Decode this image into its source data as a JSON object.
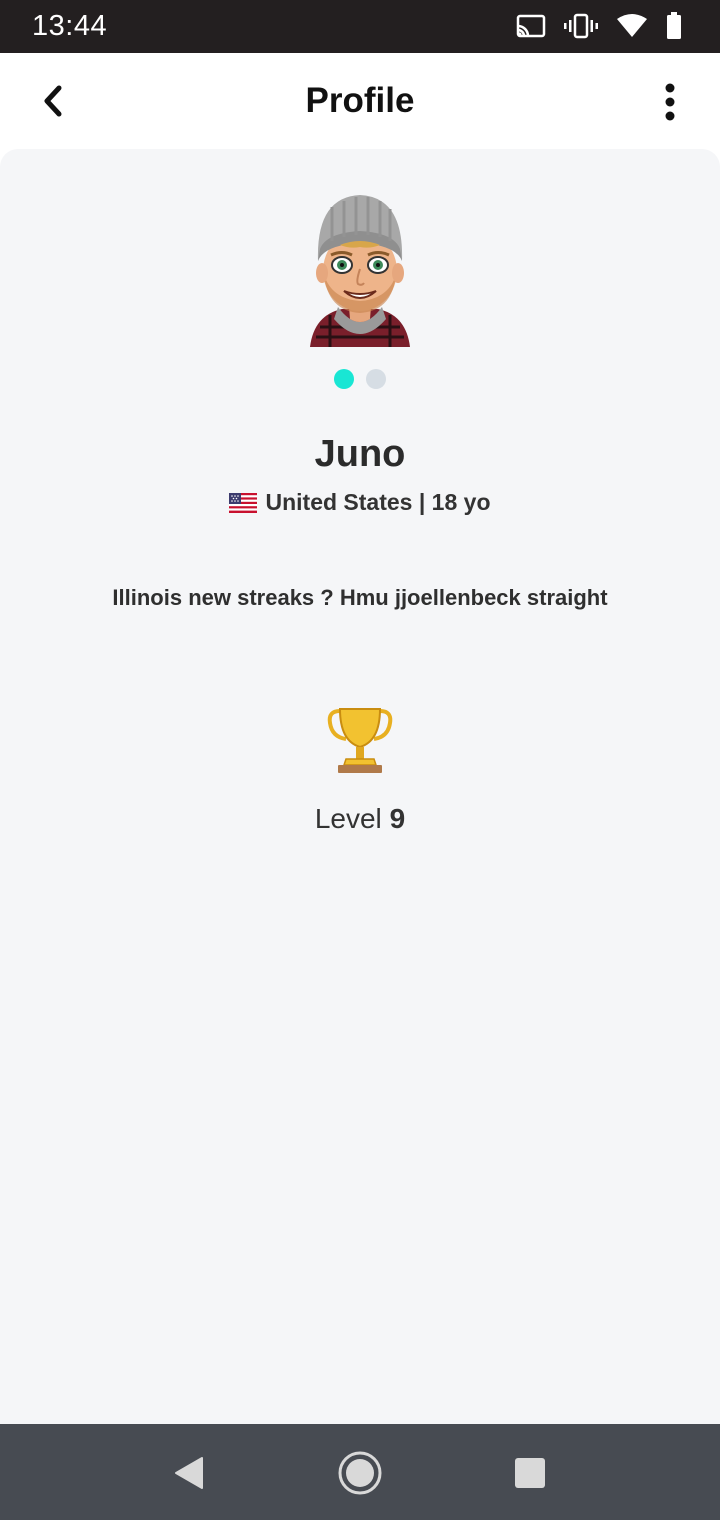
{
  "status_bar": {
    "time": "13:44",
    "icons": [
      "cast-icon",
      "vibrate-icon",
      "wifi-icon",
      "battery-icon"
    ]
  },
  "header": {
    "title": "Profile",
    "back_icon": "chevron-left-icon",
    "menu_icon": "more-vertical-icon"
  },
  "profile": {
    "name": "Juno",
    "flag_icon": "us-flag-icon",
    "location_age": "United States | 18 yo",
    "bio": "Illinois new streaks ? Hmu jjoellenbeck straight",
    "carousel": {
      "active_index": 0,
      "count": 2
    },
    "level_label": "Level",
    "level_value": "9"
  },
  "colors": {
    "accent": "#19e6d4",
    "content_bg": "#f5f6f8",
    "status_bar_bg": "#231f20",
    "nav_bar_bg": "#474b52"
  },
  "nav_bar": {
    "icons": [
      "back-triangle-icon",
      "home-circle-icon",
      "recents-square-icon"
    ]
  }
}
